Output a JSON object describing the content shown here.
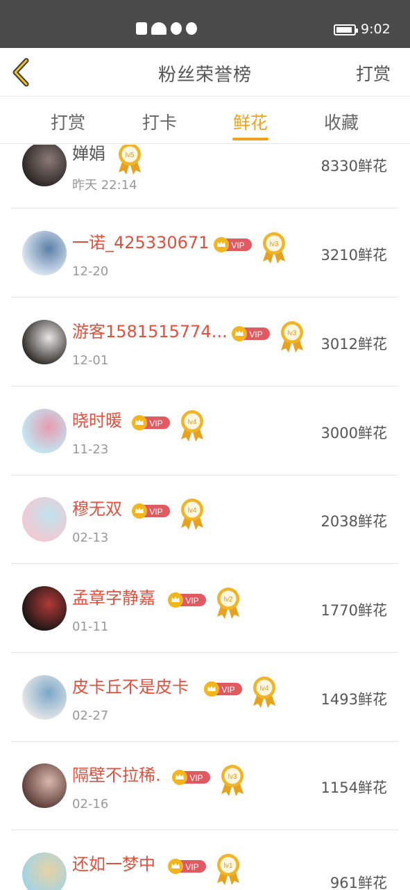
{
  "status_bar": {
    "time": "9:02",
    "battery_level": 0.9,
    "icons": [
      "sim-alert-icon",
      "wifi-icon",
      "browser-icon",
      "qq-icon"
    ]
  },
  "header": {
    "back_icon": "chevron-left-icon",
    "title": "粉丝荣誉榜",
    "action_label": "打赏"
  },
  "tabs": [
    {
      "label": "打赏",
      "active": false
    },
    {
      "label": "打卡",
      "active": false
    },
    {
      "label": "鲜花",
      "active": true
    },
    {
      "label": "收藏",
      "active": false
    }
  ],
  "colors": {
    "accent": "#f0a21a",
    "vip_name": "#e0503c",
    "normal_name": "#555555",
    "vip_badge": "#e05a62"
  },
  "fans": [
    {
      "name": "婵娟",
      "vip": false,
      "level": "lv5",
      "date": "昨天 22:14",
      "count": "8330鲜花"
    },
    {
      "name": "一诺_425330671",
      "vip": true,
      "level": "lv3",
      "date": "12-20",
      "count": "3210鲜花"
    },
    {
      "name": "游客1581515774...",
      "vip": true,
      "level": "lv3",
      "date": "12-01",
      "count": "3012鲜花"
    },
    {
      "name": "晓时暖",
      "vip": true,
      "level": "lv4",
      "date": "11-23",
      "count": "3000鲜花"
    },
    {
      "name": "穆无双",
      "vip": true,
      "level": "lv4",
      "date": "02-13",
      "count": "2038鲜花"
    },
    {
      "name": "孟章字静嘉",
      "vip": true,
      "level": "lv2",
      "date": "01-11",
      "count": "1770鲜花"
    },
    {
      "name": "皮卡丘不是皮卡",
      "vip": true,
      "level": "lv4",
      "date": "02-27",
      "count": "1493鲜花"
    },
    {
      "name": "隔壁不拉稀.",
      "vip": true,
      "level": "lv3",
      "date": "02-16",
      "count": "1154鲜花"
    },
    {
      "name": "还如一梦中",
      "vip": true,
      "level": "lv1",
      "date": "",
      "count": "961鲜花"
    }
  ],
  "vip_label": "VIP"
}
